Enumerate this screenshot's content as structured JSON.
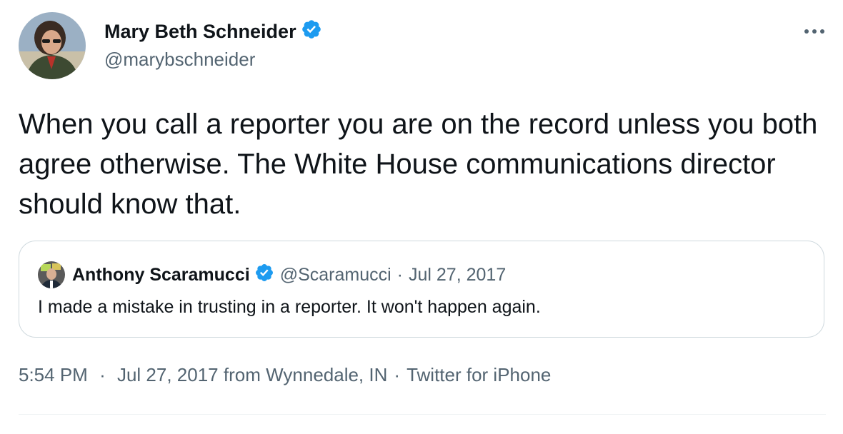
{
  "author": {
    "name": "Mary Beth Schneider",
    "handle": "@marybschneider",
    "verified": true
  },
  "tweet": {
    "text": "When you call a reporter you are on the record unless you both agree otherwise. The White House communications director should know that."
  },
  "quoted_tweet": {
    "name": "Anthony Scaramucci",
    "handle": "@Scaramucci",
    "separator": "·",
    "date": "Jul 27, 2017",
    "verified": true,
    "text": "I made a mistake in trusting in a reporter. It won't happen again."
  },
  "meta": {
    "time": "5:54 PM",
    "separator": "·",
    "date_location": "Jul 27, 2017 from Wynnedale, IN",
    "source": "Twitter for iPhone"
  },
  "colors": {
    "verified_blue": "#1d9bf0",
    "secondary_text": "#536471",
    "primary_text": "#0f1419",
    "border": "#cfd9de"
  },
  "icons": [
    "verified-badge-icon",
    "more-options-icon"
  ]
}
